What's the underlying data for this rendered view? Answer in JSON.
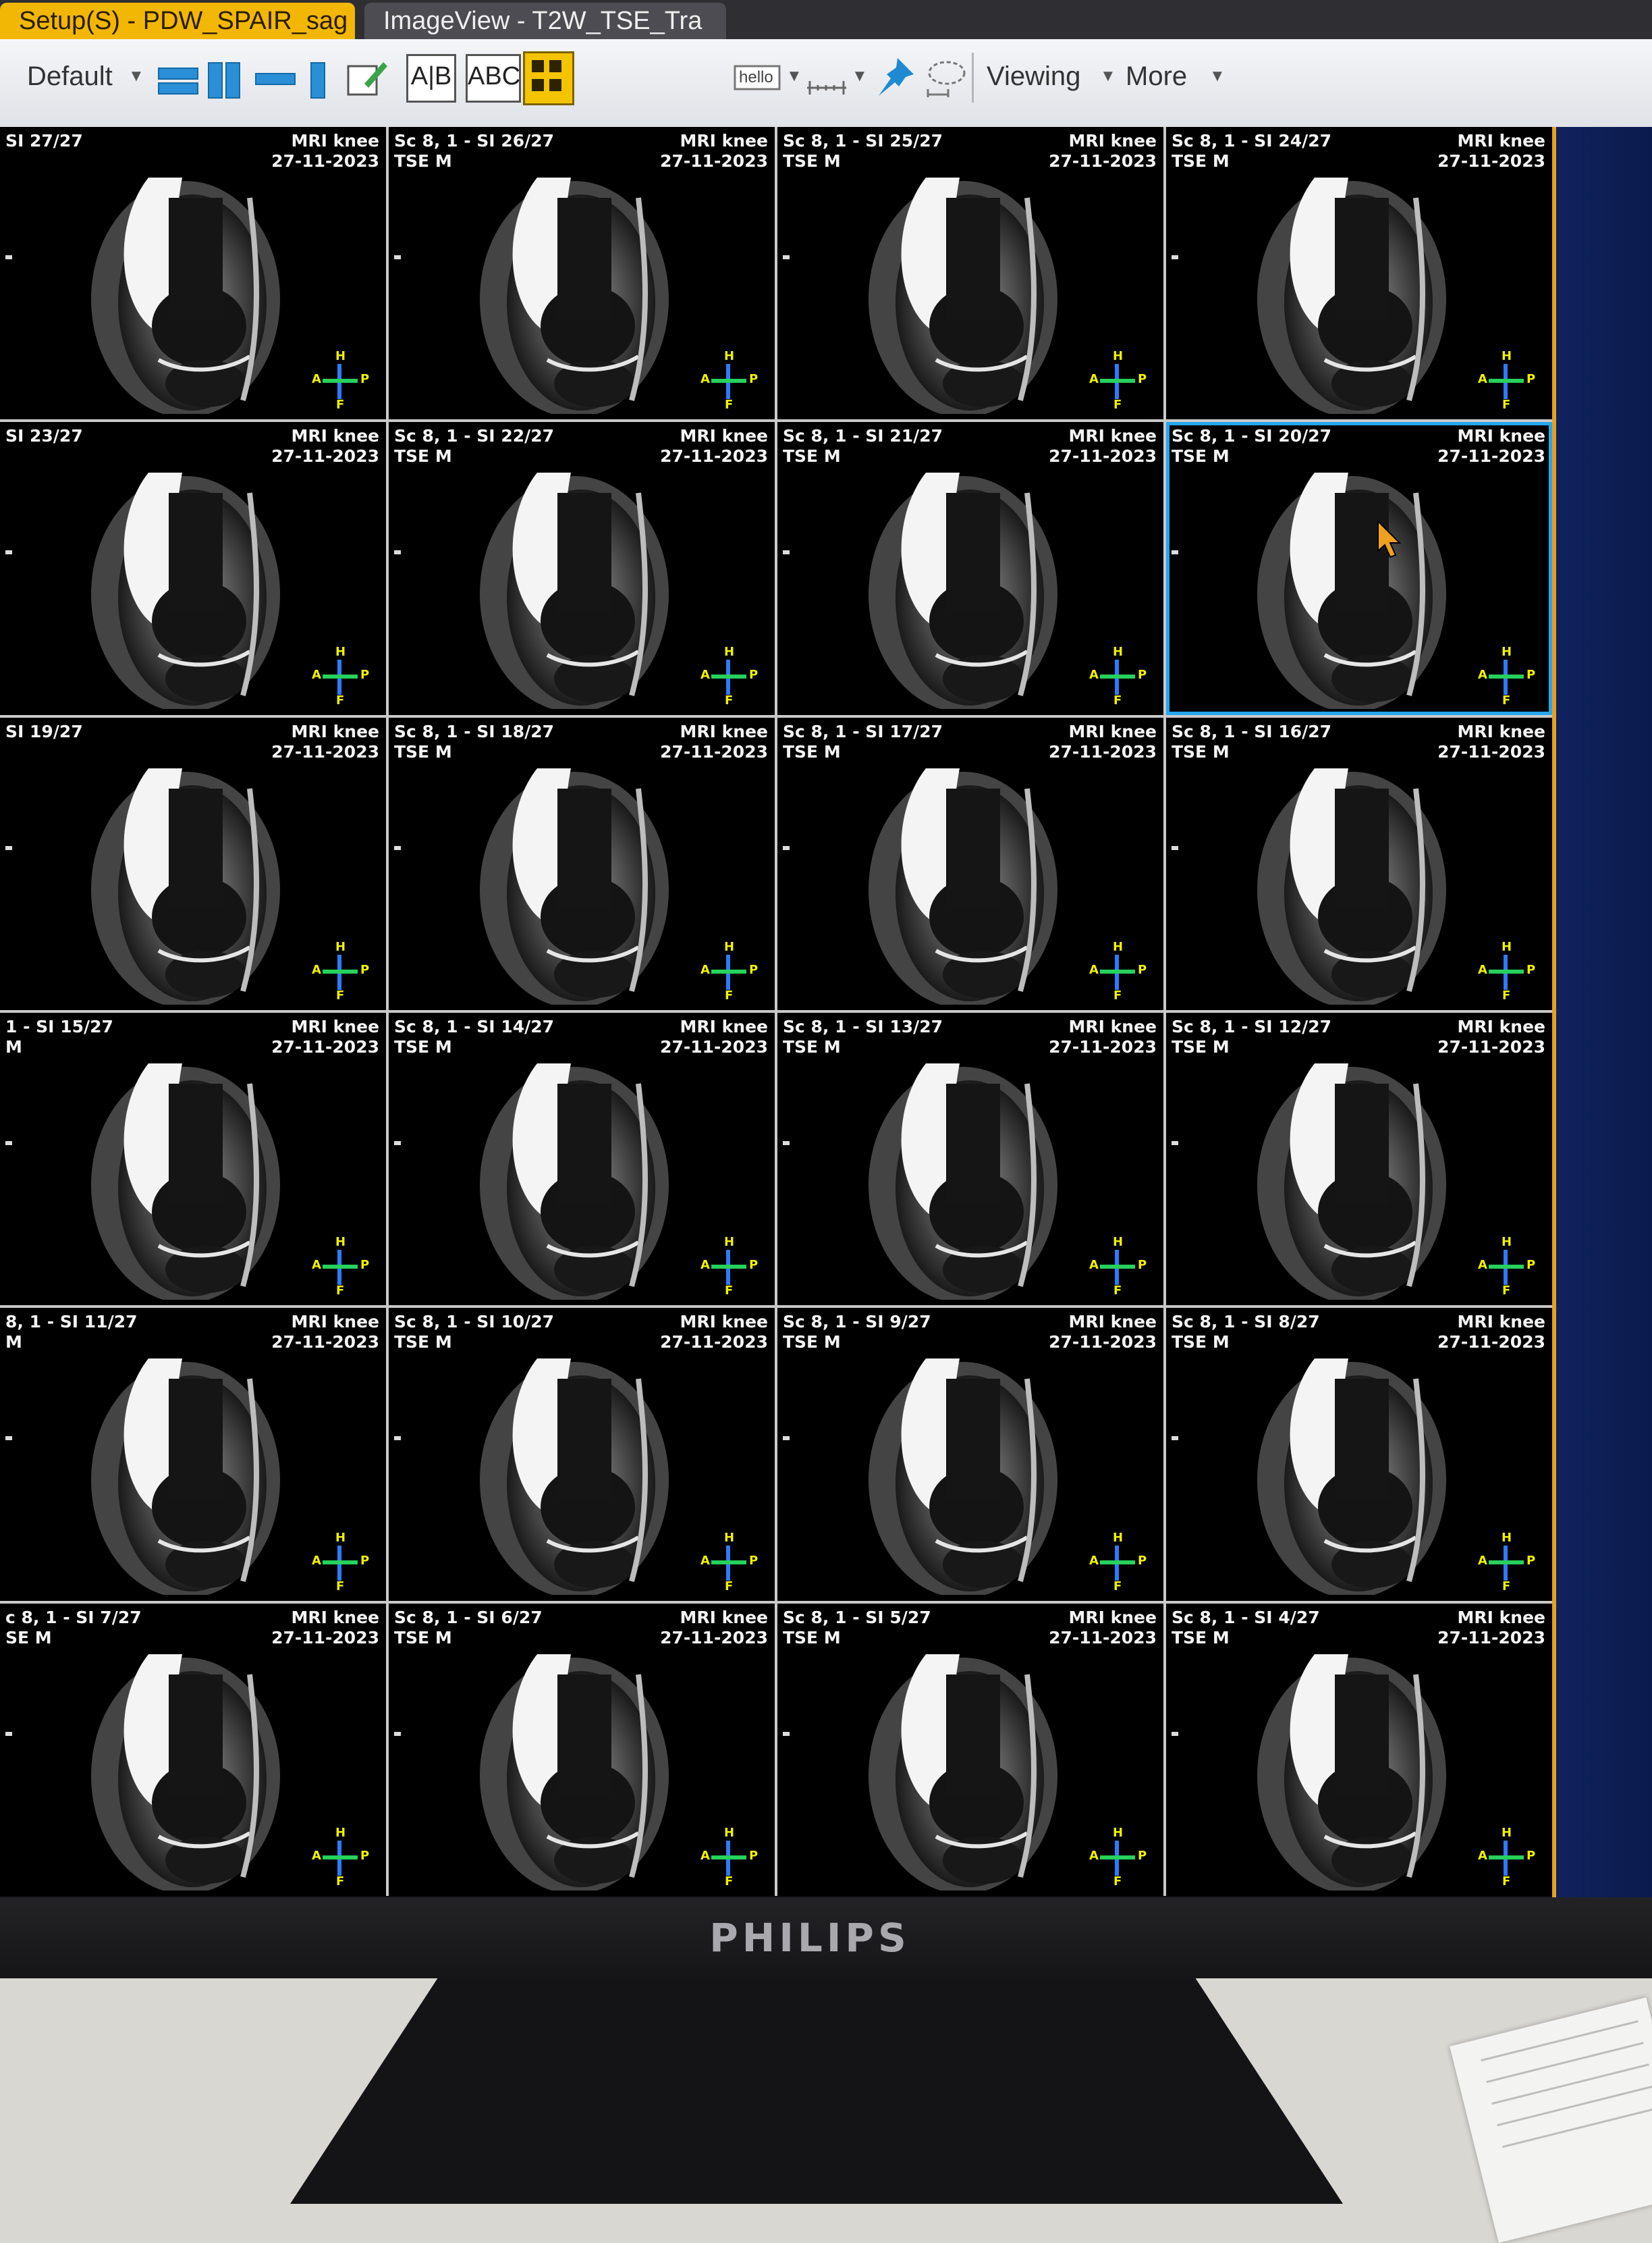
{
  "tabs": [
    {
      "label": "Setup(S) - PDW_SPAIR_sag",
      "active": true
    },
    {
      "label": "ImageView - T2W_TSE_Tra",
      "active": false
    }
  ],
  "toolbar": {
    "preset_label": "Default",
    "annot_ab": "A|B",
    "annot_abc": "ABC",
    "text_tool": "hello",
    "viewing_label": "Viewing",
    "more_label": "More"
  },
  "viewer": {
    "colors": {
      "tile_border": "#c9c9c9",
      "selected": "#25a6ef",
      "orient_v": "#2f7bff",
      "orient_h": "#26d15c"
    },
    "orientation": {
      "top": "H",
      "bottom": "F",
      "left": "A",
      "right": "P"
    },
    "tiles": [
      {
        "series": "SI 27/27",
        "protocol": "",
        "study": "MRI knee",
        "date": "27-11-2023"
      },
      {
        "series": "Sc 8, 1 - SI 26/27",
        "protocol": "TSE M",
        "study": "MRI knee",
        "date": "27-11-2023"
      },
      {
        "series": "Sc 8, 1 - SI 25/27",
        "protocol": "TSE M",
        "study": "MRI knee",
        "date": "27-11-2023"
      },
      {
        "series": "Sc 8, 1 - SI 24/27",
        "protocol": "TSE M",
        "study": "MRI knee",
        "date": "27-11-2023"
      },
      {
        "series": "SI 23/27",
        "protocol": "",
        "study": "MRI knee",
        "date": "27-11-2023"
      },
      {
        "series": "Sc 8, 1 - SI 22/27",
        "protocol": "TSE M",
        "study": "MRI knee",
        "date": "27-11-2023"
      },
      {
        "series": "Sc 8, 1 - SI 21/27",
        "protocol": "TSE M",
        "study": "MRI knee",
        "date": "27-11-2023"
      },
      {
        "series": "Sc 8, 1 - SI 20/27",
        "protocol": "TSE M",
        "study": "MRI knee",
        "date": "27-11-2023",
        "selected": true
      },
      {
        "series": "SI 19/27",
        "protocol": "",
        "study": "MRI knee",
        "date": "27-11-2023"
      },
      {
        "series": "Sc 8, 1 - SI 18/27",
        "protocol": "TSE M",
        "study": "MRI knee",
        "date": "27-11-2023"
      },
      {
        "series": "Sc 8, 1 - SI 17/27",
        "protocol": "TSE M",
        "study": "MRI knee",
        "date": "27-11-2023"
      },
      {
        "series": "Sc 8, 1 - SI 16/27",
        "protocol": "TSE M",
        "study": "MRI knee",
        "date": "27-11-2023"
      },
      {
        "series": "1 - SI 15/27",
        "protocol": "M",
        "study": "MRI knee",
        "date": "27-11-2023"
      },
      {
        "series": "Sc 8, 1 - SI 14/27",
        "protocol": "TSE M",
        "study": "MRI knee",
        "date": "27-11-2023"
      },
      {
        "series": "Sc 8, 1 - SI 13/27",
        "protocol": "TSE M",
        "study": "MRI knee",
        "date": "27-11-2023"
      },
      {
        "series": "Sc 8, 1 - SI 12/27",
        "protocol": "TSE M",
        "study": "MRI knee",
        "date": "27-11-2023"
      },
      {
        "series": "8, 1 - SI 11/27",
        "protocol": "M",
        "study": "MRI knee",
        "date": "27-11-2023"
      },
      {
        "series": "Sc 8, 1 - SI 10/27",
        "protocol": "TSE M",
        "study": "MRI knee",
        "date": "27-11-2023"
      },
      {
        "series": "Sc 8, 1 - SI 9/27",
        "protocol": "TSE M",
        "study": "MRI knee",
        "date": "27-11-2023"
      },
      {
        "series": "Sc 8, 1 - SI 8/27",
        "protocol": "TSE M",
        "study": "MRI knee",
        "date": "27-11-2023"
      },
      {
        "series": "c 8, 1 - SI 7/27",
        "protocol": "SE M",
        "study": "MRI knee",
        "date": "27-11-2023"
      },
      {
        "series": "Sc 8, 1 - SI 6/27",
        "protocol": "TSE M",
        "study": "MRI knee",
        "date": "27-11-2023"
      },
      {
        "series": "Sc 8, 1 - SI 5/27",
        "protocol": "TSE M",
        "study": "MRI knee",
        "date": "27-11-2023"
      },
      {
        "series": "Sc 8, 1 - SI 4/27",
        "protocol": "TSE M",
        "study": "MRI knee",
        "date": "27-11-2023"
      }
    ]
  },
  "monitor": {
    "brand": "PHILIPS"
  }
}
